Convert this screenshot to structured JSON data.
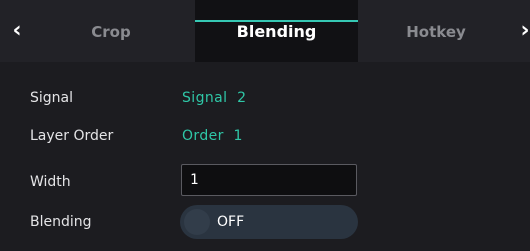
{
  "tabs": {
    "prev_icon": "chevron-left-icon",
    "next_icon": "chevron-right-icon",
    "items": [
      {
        "label": "Crop",
        "active": false
      },
      {
        "label": "Blending",
        "active": true
      },
      {
        "label": "Hotkey",
        "active": false
      }
    ]
  },
  "fields": {
    "signal": {
      "label": "Signal",
      "value": "Signal  2"
    },
    "layer_order": {
      "label": "Layer Order",
      "value": "Order  1"
    },
    "width": {
      "label": "Width",
      "value": "1"
    },
    "blending": {
      "label": "Blending",
      "value": "OFF",
      "enabled": false
    }
  },
  "colors": {
    "accent": "#2fc7a7",
    "active_indicator": "#36c8b4",
    "background": "#1c1c20",
    "toggle_off": "#2a3440"
  }
}
